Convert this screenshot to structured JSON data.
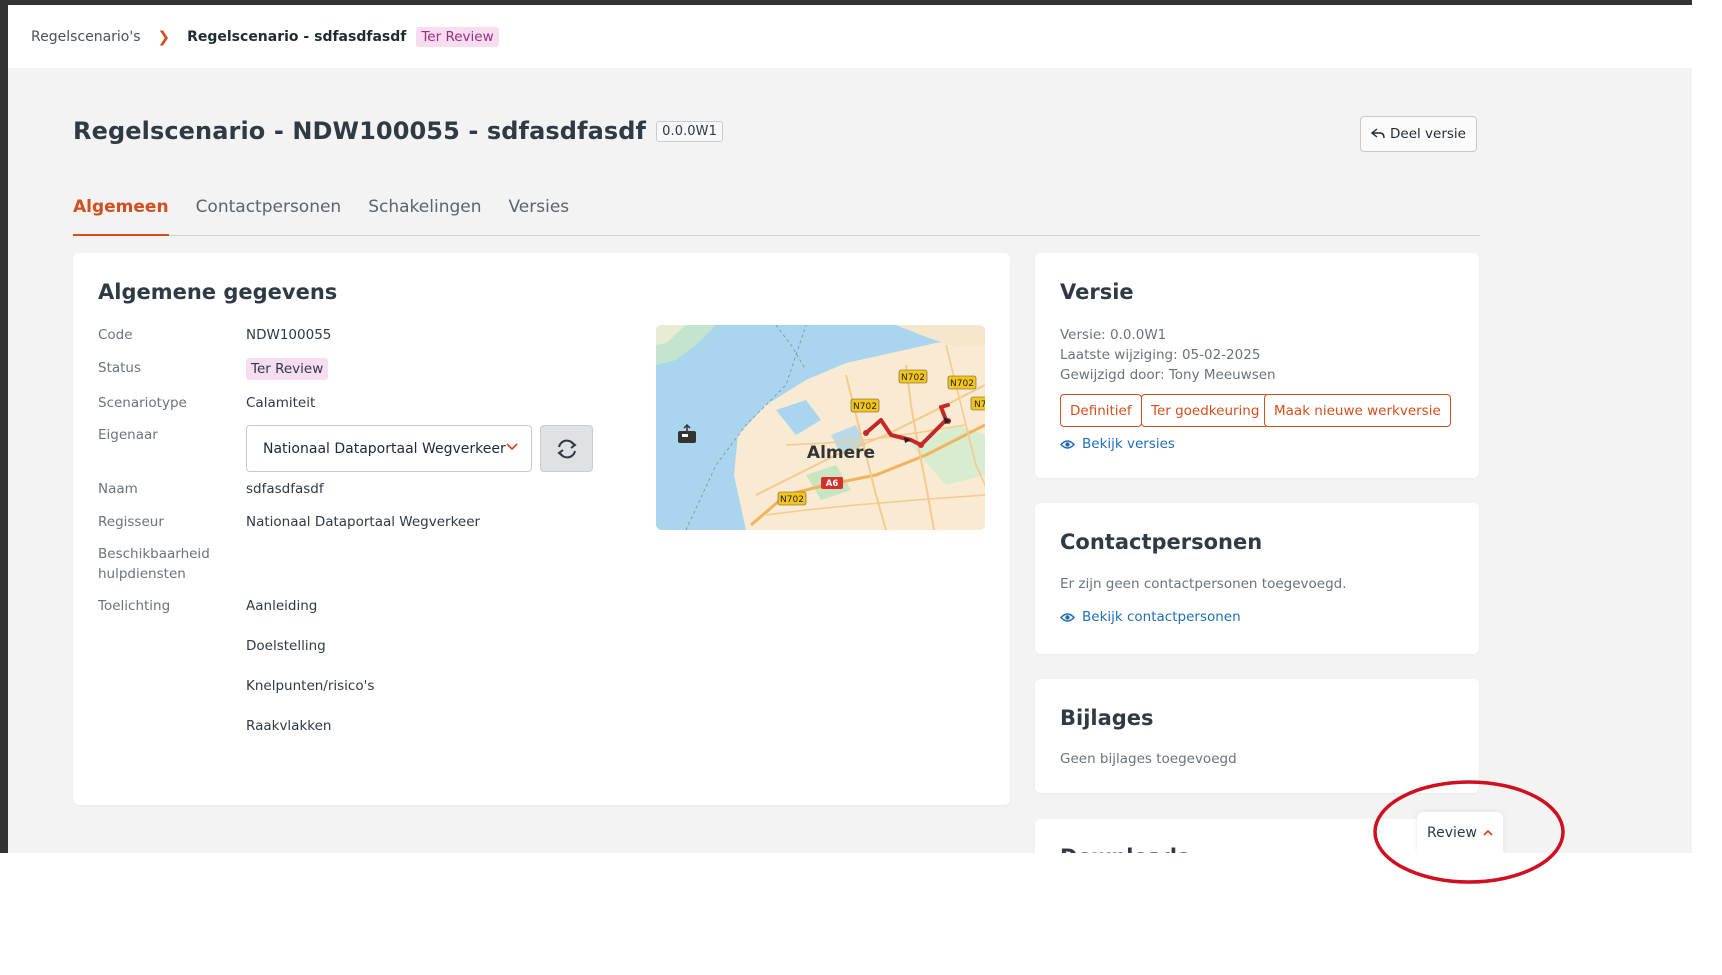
{
  "breadcrumb": {
    "root": "Regelscenario's",
    "current": "Regelscenario - sdfasdfasdf",
    "status": "Ter Review"
  },
  "header": {
    "title": "Regelscenario - NDW100055 - sdfasdfasdf",
    "version": "0.0.0W1",
    "share_label": "Deel versie"
  },
  "tabs": [
    {
      "label": "Algemeen",
      "active": true
    },
    {
      "label": "Contactpersonen",
      "active": false
    },
    {
      "label": "Schakelingen",
      "active": false
    },
    {
      "label": "Versies",
      "active": false
    }
  ],
  "general": {
    "title": "Algemene gegevens",
    "code": {
      "label": "Code",
      "value": "NDW100055"
    },
    "status": {
      "label": "Status",
      "value": "Ter Review"
    },
    "scenariotype": {
      "label": "Scenariotype",
      "value": "Calamiteit"
    },
    "eigenaar": {
      "label": "Eigenaar",
      "value": "Nationaal Dataportaal Wegverkeer"
    },
    "naam": {
      "label": "Naam",
      "value": "sdfasdfasdf"
    },
    "regisseur": {
      "label": "Regisseur",
      "value": "Nationaal Dataportaal Wegverkeer"
    },
    "beschikbaarheid": {
      "label_line1": "Beschikbaarheid",
      "label_line2": "hulpdiensten"
    },
    "toelichting": {
      "label": "Toelichting",
      "items": [
        "Aanleiding",
        "Doelstelling",
        "Knelpunten/risico's",
        "Raakvlakken"
      ]
    }
  },
  "map": {
    "city": "Almere",
    "road_labels": [
      "N702",
      "N702",
      "N702",
      "N702",
      "N7",
      "A6"
    ]
  },
  "version_card": {
    "title": "Versie",
    "version": "Versie: 0.0.0W1",
    "last_change": "Laatste wijziging: 05-02-2025",
    "changed_by": "Gewijzigd door: Tony Meeuwsen",
    "buttons": [
      "Definitief",
      "Ter goedkeuring",
      "Maak nieuwe werkversie"
    ],
    "link": "Bekijk versies"
  },
  "contacts_card": {
    "title": "Contactpersonen",
    "empty": "Er zijn geen contactpersonen toegevoegd.",
    "link": "Bekijk contactpersonen"
  },
  "attachments_card": {
    "title": "Bijlages",
    "empty": "Geen bijlages toegevoegd"
  },
  "last_card": {
    "title": "Downloads"
  },
  "review_button": {
    "label": "Review"
  },
  "colors": {
    "accent": "#d2501e",
    "link": "#1e6fb8",
    "badge_bg": "#f7ddef",
    "badge_text": "#9b2d87",
    "annotation": "#d0101e"
  }
}
